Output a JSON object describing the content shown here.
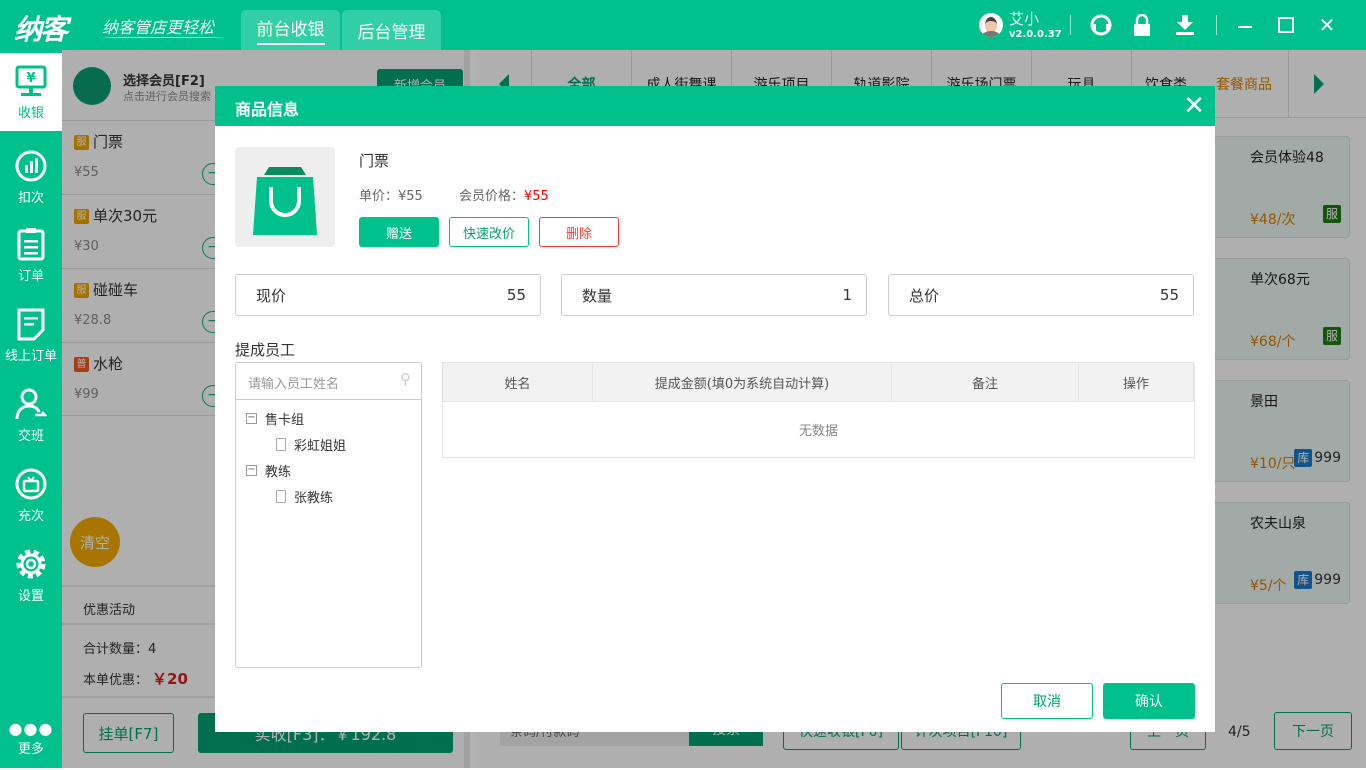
{
  "header": {
    "logo": "纳客",
    "slogan": "纳客管店更轻松",
    "tabs": [
      {
        "label": "前台收银",
        "active": true
      },
      {
        "label": "后台管理",
        "active": false
      }
    ],
    "user_name": "艾小",
    "version": "v2.0.0.37",
    "icons": [
      "headset-icon",
      "lock-icon",
      "download-icon",
      "minimize-icon",
      "maximize-icon",
      "close-icon"
    ]
  },
  "sidebar": {
    "items": [
      {
        "label": "收银",
        "icon": "cashier-icon"
      },
      {
        "label": "扣次",
        "icon": "chart-icon"
      },
      {
        "label": "订单",
        "icon": "order-icon"
      },
      {
        "label": "线上订单",
        "icon": "online-order-icon"
      },
      {
        "label": "交班",
        "icon": "handover-icon"
      },
      {
        "label": "充次",
        "icon": "recharge-icon"
      },
      {
        "label": "设置",
        "icon": "gear-icon"
      }
    ],
    "more": "更多"
  },
  "member": {
    "title": "选择会员[F2]",
    "subtitle": "点击进行会员搜索",
    "new_button": "新增会员"
  },
  "cart": {
    "items": [
      {
        "badge": "服",
        "name": "门票",
        "price": "¥55"
      },
      {
        "badge": "服",
        "name": "单次30元",
        "price": "¥30"
      },
      {
        "badge": "服",
        "name": "碰碰车",
        "price": "¥28.8"
      },
      {
        "badge": "普",
        "name": "水枪",
        "price": "¥99"
      }
    ],
    "clear": "清空",
    "promo": "优惠活动",
    "total_qty_label": "合计数量：",
    "total_qty": "4",
    "discount_label": "本单优惠：",
    "discount": "￥20",
    "hang_button": "挂单[F7]",
    "pay_button": "实收[F3]：￥192.8"
  },
  "categories": [
    "全部",
    "成人街舞课",
    "游乐项目",
    "轨道影院",
    "游乐场门票",
    "玩具",
    "饮食类",
    "套餐商品"
  ],
  "products": [
    {
      "name": "会员体验48",
      "price": "¥48/次",
      "tag": "服",
      "stock": ""
    },
    {
      "name": "单次68元",
      "price": "¥68/个",
      "tag": "服",
      "stock": ""
    },
    {
      "name": "景田",
      "price": "¥10/只",
      "tag": "库",
      "stock": "999"
    },
    {
      "name": "农夫山泉",
      "price": "¥5/个",
      "tag": "库",
      "stock": "999"
    }
  ],
  "bottom": {
    "search_placeholder": "条码/付款码",
    "search_button": "搜索",
    "quick_cash": "快速收银[F6]",
    "count_items": "计次项目[F10]",
    "prev": "上一页",
    "page": "4/5",
    "next": "下一页"
  },
  "dialog": {
    "title": "商品信息",
    "product_name": "门票",
    "unit_price_label": "单价：",
    "unit_price": "¥55",
    "member_price_label": "会员价格：",
    "member_price": "¥55",
    "gift_button": "赠送",
    "quick_price_button": "快速改价",
    "delete_button": "删除",
    "current_price_label": "现价",
    "current_price": "55",
    "qty_label": "数量",
    "qty": "1",
    "total_label": "总价",
    "total": "55",
    "staff_section": "提成员工",
    "staff_search_placeholder": "请输入员工姓名",
    "tree": [
      {
        "group": "售卡组",
        "members": [
          "彩虹姐姐"
        ]
      },
      {
        "group": "教练",
        "members": [
          "张教练"
        ]
      }
    ],
    "columns": [
      "姓名",
      "提成金额(填0为系统自动计算)",
      "备注",
      "操作"
    ],
    "empty": "无数据",
    "cancel": "取消",
    "confirm": "确认"
  },
  "colors": {
    "brand": "#00c08b",
    "dark_green": "#00a070",
    "orange": "#d47a00",
    "red": "#e00000",
    "badge_service": "#1a7a10",
    "badge_stock": "#1a78c8"
  }
}
